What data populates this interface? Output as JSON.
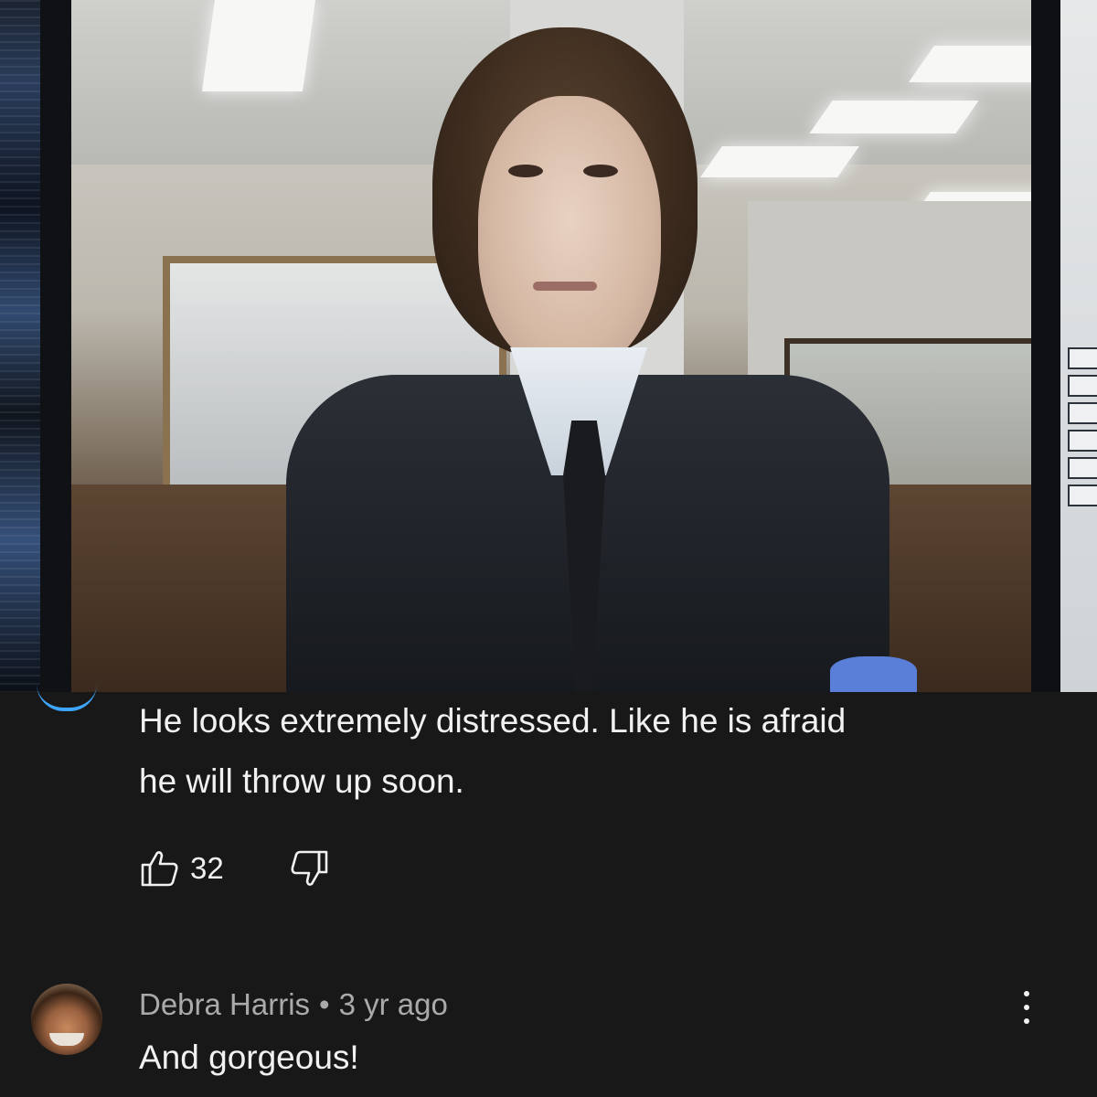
{
  "comment": {
    "text_line1": "He looks extremely distressed. Like he is afraid",
    "text_line2": "he will throw up soon.",
    "like_count": "32",
    "icons": {
      "like": "thumbs-up-icon",
      "dislike": "thumbs-down-icon"
    }
  },
  "reply": {
    "author": "Debra Harris",
    "separator": "•",
    "age": "3 yr ago",
    "text": "And gorgeous!",
    "icons": {
      "more": "more-vert-icon"
    }
  },
  "colors": {
    "background": "#181818",
    "text": "#f1f1f1",
    "meta": "#aaaaaa",
    "accent": "#3ea6ff"
  }
}
